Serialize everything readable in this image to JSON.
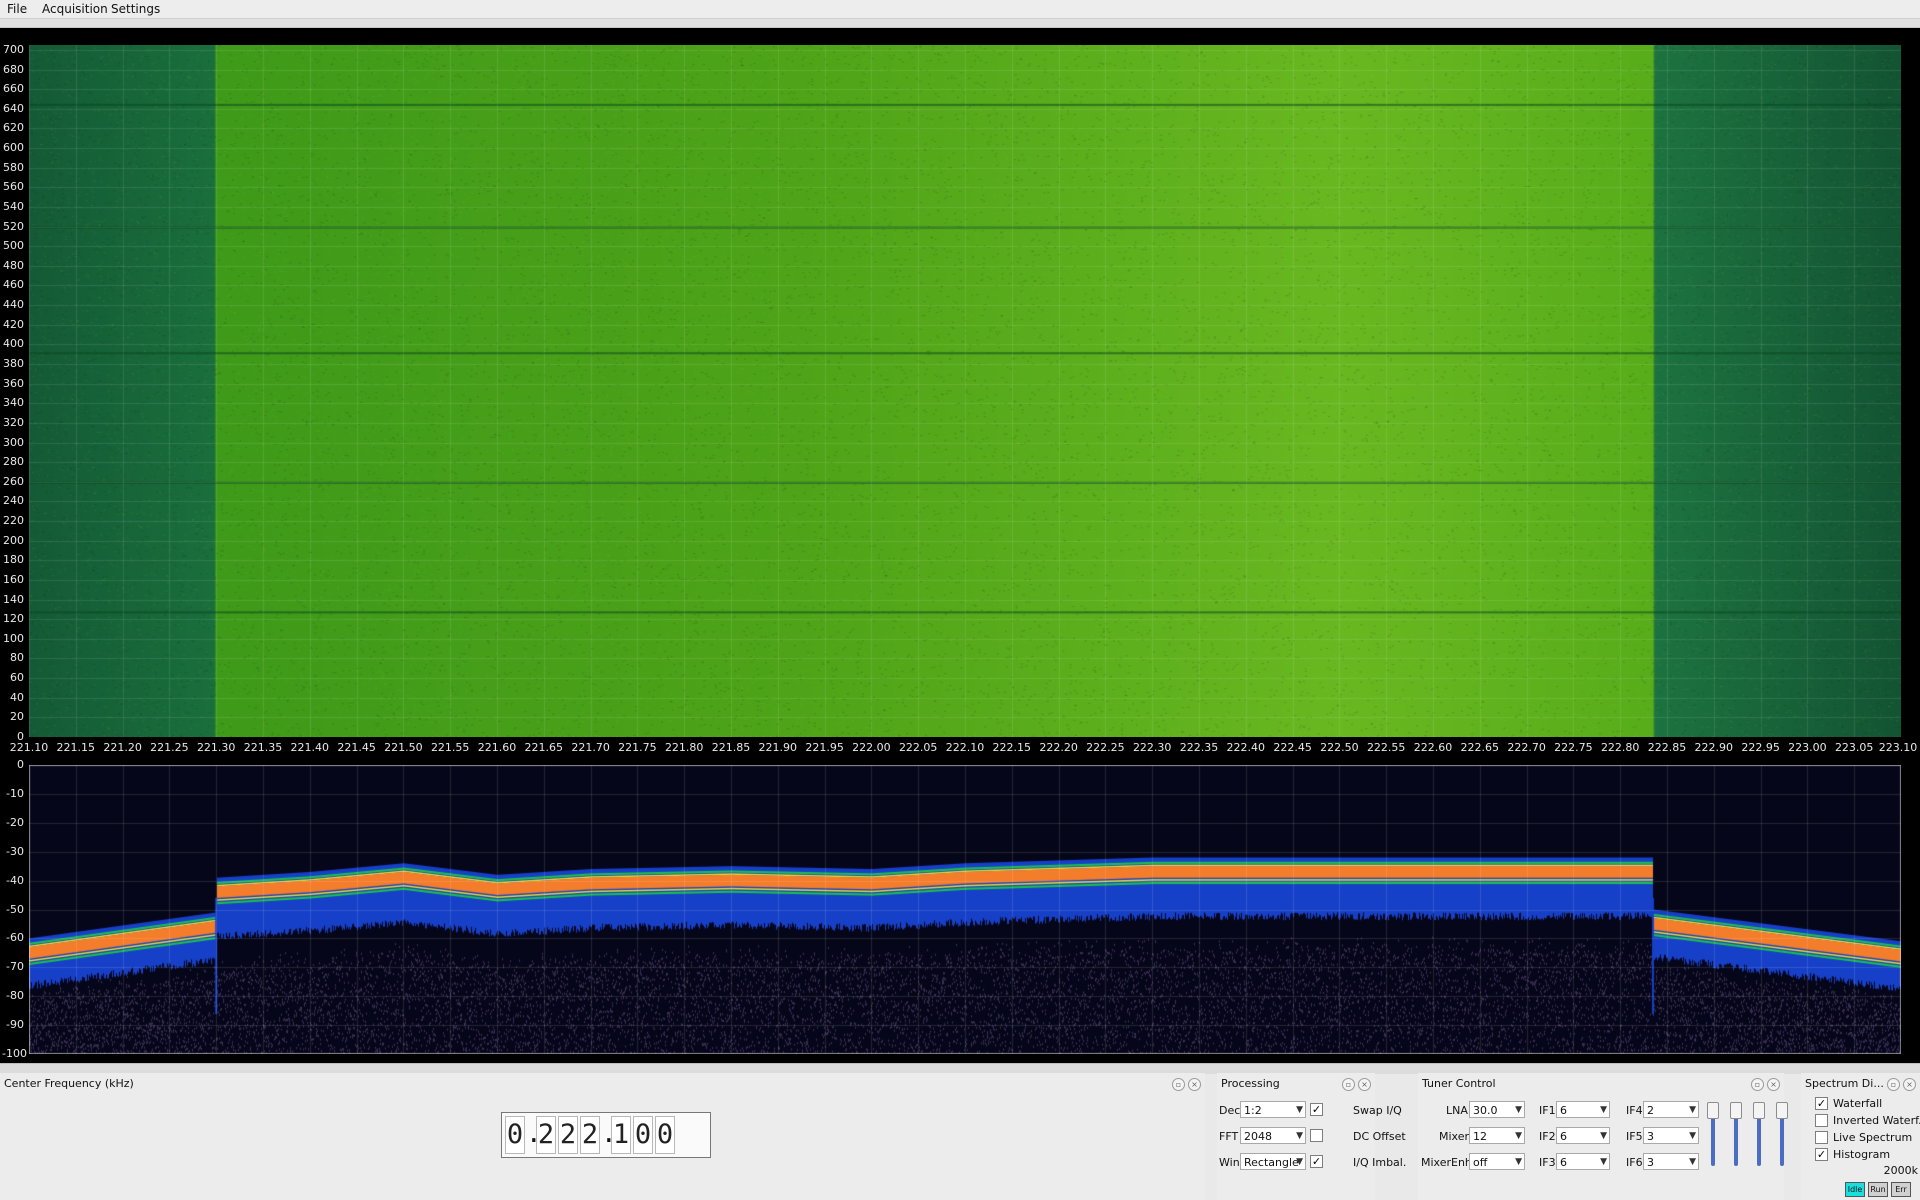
{
  "menu": {
    "file": "File",
    "acquisition": "Acquisition",
    "settings": "Settings"
  },
  "waterfall": {
    "y_ticks": [
      "700",
      "680",
      "660",
      "640",
      "620",
      "600",
      "580",
      "560",
      "540",
      "520",
      "500",
      "480",
      "460",
      "440",
      "420",
      "400",
      "380",
      "360",
      "340",
      "320",
      "300",
      "280",
      "260",
      "240",
      "220",
      "200",
      "180",
      "160",
      "140",
      "120",
      "100",
      "80",
      "60",
      "40",
      "20",
      "0"
    ],
    "y_range": [
      0,
      705
    ],
    "dark_line_rows": [
      645,
      520,
      392,
      260,
      128
    ],
    "colors": {
      "edge": "#176b3a",
      "band": "#4ea418",
      "center": "#6ab520"
    }
  },
  "freq_axis": {
    "labels": [
      "221.10",
      "221.15",
      "221.20",
      "221.25",
      "221.30",
      "221.35",
      "221.40",
      "221.45",
      "221.50",
      "221.55",
      "221.60",
      "221.65",
      "221.70",
      "221.75",
      "221.80",
      "221.85",
      "221.90",
      "221.95",
      "222.00",
      "222.05",
      "222.10",
      "222.15",
      "222.20",
      "222.25",
      "222.30",
      "222.35",
      "222.40",
      "222.45",
      "222.50",
      "222.55",
      "222.60",
      "222.65",
      "222.70",
      "222.75",
      "222.80",
      "222.85",
      "222.90",
      "222.95",
      "223.00",
      "223.05",
      "223.10"
    ],
    "min": 221.1,
    "max": 223.1,
    "band_start": 221.3,
    "band_end": 222.835
  },
  "spectrum": {
    "y_ticks": [
      "0",
      "-10",
      "-20",
      "-30",
      "-40",
      "-50",
      "-60",
      "-70",
      "-80",
      "-90",
      "-100"
    ],
    "y_range": [
      -100,
      0
    ],
    "band_profile": [
      [
        221.3,
        -44
      ],
      [
        221.4,
        -42
      ],
      [
        221.5,
        -39
      ],
      [
        221.6,
        -43
      ],
      [
        221.7,
        -41
      ],
      [
        221.85,
        -40
      ],
      [
        222.0,
        -41
      ],
      [
        222.1,
        -39
      ],
      [
        222.3,
        -37
      ],
      [
        222.6,
        -37
      ],
      [
        222.835,
        -37
      ]
    ],
    "edge_profile_left": [
      [
        221.1,
        -65
      ],
      [
        221.3,
        -56
      ]
    ],
    "edge_profile_right": [
      [
        222.835,
        -55
      ],
      [
        223.1,
        -66
      ]
    ],
    "colors": {
      "bg": "#06061a",
      "blue": "#1740c8",
      "orange": "#f47d2b",
      "yellow": "#e6e02a",
      "green": "#1ec24a",
      "noise": "#3e3257"
    }
  },
  "center_frequency": {
    "title": "Center Frequency (kHz)",
    "digits": [
      "0",
      ".",
      "2",
      "2",
      "2",
      ".",
      "1",
      "0",
      "0"
    ]
  },
  "processing": {
    "title": "Processing",
    "dec_label": "Dec",
    "dec_value": "1:2",
    "fft_label": "FFT",
    "fft_value": "2048",
    "win_label": "Win",
    "win_value": "Rectangle",
    "swap_iq": "Swap I/Q",
    "dc_offset": "DC Offset",
    "iq_imbal": "I/Q Imbal.",
    "swap_iq_checked": true,
    "dc_offset_checked": false,
    "iq_imbal_checked": true
  },
  "tuner": {
    "title": "Tuner Control",
    "lna_label": "LNA",
    "lna_value": "30.0",
    "mixer_label": "Mixer",
    "mixer_value": "12",
    "mixerenh_label": "MixerEnh",
    "mixerenh_value": "off",
    "if1_label": "IF1",
    "if1_value": "6",
    "if2_label": "IF2",
    "if2_value": "6",
    "if3_label": "IF3",
    "if3_value": "6",
    "if4_label": "IF4",
    "if4_value": "2",
    "if5_label": "IF5",
    "if5_value": "3",
    "if6_label": "IF6",
    "if6_value": "3"
  },
  "spectrum_display": {
    "title": "Spectrum Di...",
    "waterfall": "Waterfall",
    "inverted_waterfall": "Inverted Waterf.",
    "live_spectrum": "Live Spectrum",
    "histogram": "Histogram",
    "waterfall_checked": true,
    "inverted_checked": false,
    "live_checked": false,
    "histogram_checked": true,
    "rate": "2000k"
  },
  "status": {
    "idle": "Idle",
    "run": "Run",
    "err": "Err",
    "idle_color": "#19e0e0"
  },
  "icons": {
    "float": "float-icon",
    "close": "close-icon"
  }
}
